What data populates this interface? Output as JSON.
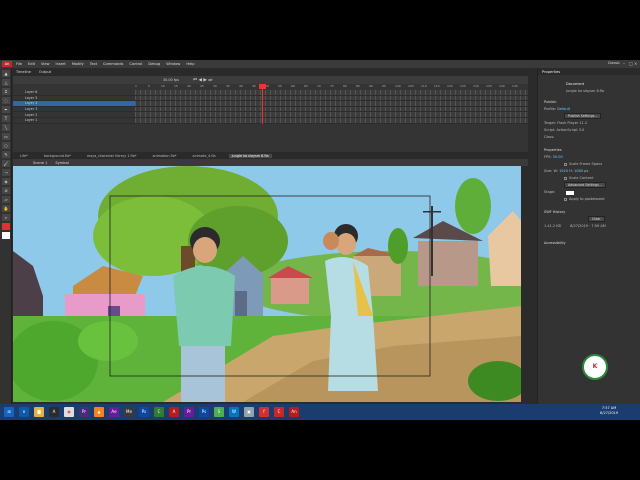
{
  "menu": {
    "logo": "An",
    "items": [
      "File",
      "Edit",
      "View",
      "Insert",
      "Modify",
      "Text",
      "Commands",
      "Control",
      "Debug",
      "Window",
      "Help"
    ],
    "workspace": "Classic"
  },
  "timeline": {
    "tabs": [
      "Timeline",
      "Output"
    ],
    "layers": [
      "Layer 6",
      "Layer 5",
      "Layer 4",
      "Layer 3",
      "Layer 2",
      "Layer 1"
    ],
    "selected_layer_index": 2,
    "fps": "30.00 fps",
    "frame_numbers": [
      "1",
      "5",
      "10",
      "15",
      "20",
      "25",
      "30",
      "35",
      "40",
      "45",
      "50",
      "55",
      "60",
      "65",
      "70",
      "75",
      "80",
      "85",
      "90",
      "95",
      "100",
      "105",
      "110",
      "115",
      "120",
      "125",
      "130",
      "135",
      "140",
      "145"
    ]
  },
  "doc_tabs": [
    "Life*",
    "background.fla*",
    "maya_character library 1.fla*",
    "animation.fla*",
    "animate_4.fla",
    "jungle ka slaysm 8.fla"
  ],
  "active_doc_index": 5,
  "scene": {
    "scene_label": "Scene 1",
    "symbol_label": "Symbol"
  },
  "properties": {
    "panel_title": "Properties",
    "doc_label": "Document",
    "doc_name": "jungle ka slaysm 8.fla",
    "publish_header": "Publish",
    "profile_label": "Profile:",
    "profile_value": "Default",
    "publish_settings_btn": "Publish Settings...",
    "target_label": "Target:",
    "target_value": "Flash Player 11.2",
    "script_label": "Script:",
    "script_value": "ActionScript 3.0",
    "class_label": "Class:",
    "props_header": "Properties",
    "fps_label": "FPS:",
    "fps_value": "30.00",
    "scale_frame_spans": "Scale Frame Spans",
    "size_label": "Size:",
    "w_label": "W:",
    "w_value": "1920",
    "h_label": "H:",
    "h_value": "1080",
    "unit": "px",
    "scale_content": "Scale Content",
    "advanced_settings_btn": "Advanced Settings...",
    "stage_label": "Stage:",
    "apply_pasteboard": "Apply to pasteboard",
    "swf_history_header": "SWF History",
    "clear_btn": "Clear",
    "history_size": "1.41.2 KB",
    "history_date": "8/27/2019 · 7:59 AM",
    "accessibility_header": "Accessibility"
  },
  "taskbar": {
    "time": "7:57 AM",
    "date": "8/27/2019"
  },
  "colors": {
    "accent": "#3465a4",
    "playhead": "#e33333",
    "sky": "#8fc9e9",
    "grass": "#5fb33a",
    "path": "#c9a66b"
  }
}
